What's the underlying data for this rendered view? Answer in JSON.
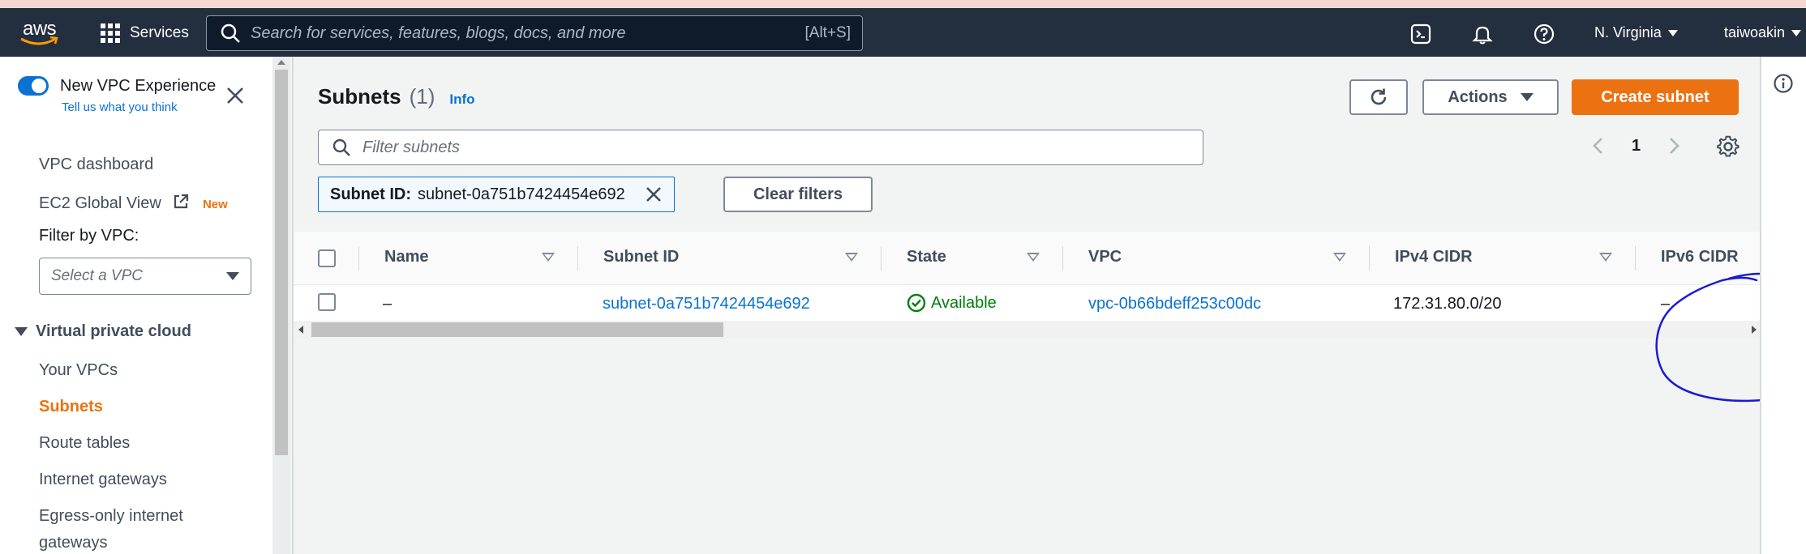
{
  "topnav": {
    "logo_text": "aws",
    "services_label": "Services",
    "search_placeholder": "Search for services, features, blogs, docs, and more",
    "search_shortcut": "[Alt+S]",
    "region": "N. Virginia",
    "user": "taiwoakin"
  },
  "sidebar": {
    "toggle_label": "New VPC Experience",
    "feedback_link": "Tell us what you think",
    "items": [
      {
        "label": "VPC dashboard"
      },
      {
        "label": "EC2 Global View",
        "badge": "New"
      },
      {
        "label": "Your VPCs"
      },
      {
        "label": "Subnets"
      },
      {
        "label": "Route tables"
      },
      {
        "label": "Internet gateways"
      },
      {
        "label": "Egress-only internet"
      },
      {
        "label": "gateways"
      }
    ],
    "filter_label": "Filter by VPC:",
    "filter_placeholder": "Select a VPC",
    "section_title": "Virtual private cloud"
  },
  "main": {
    "title": "Subnets",
    "count": "(1)",
    "info_link": "Info",
    "actions_label": "Actions",
    "create_label": "Create subnet",
    "filter_placeholder": "Filter subnets",
    "page_number": "1",
    "token_key": "Subnet ID:",
    "token_value": "subnet-0a751b7424454e692",
    "clear_filters_label": "Clear filters",
    "columns": [
      "Name",
      "Subnet ID",
      "State",
      "VPC",
      "IPv4 CIDR",
      "IPv6 CIDR"
    ],
    "rows": [
      {
        "name": "–",
        "subnet_id": "subnet-0a751b7424454e692",
        "state": "Available",
        "vpc": "vpc-0b66bdeff253c00dc",
        "ipv4_cidr": "172.31.80.0/20",
        "ipv6_cidr": "–"
      }
    ]
  },
  "colors": {
    "nav_bg": "#232f3e",
    "accent_orange": "#ec7211",
    "link_blue": "#0972d3",
    "success_green": "#037f0c",
    "annotation_blue": "#1a1ad6"
  }
}
